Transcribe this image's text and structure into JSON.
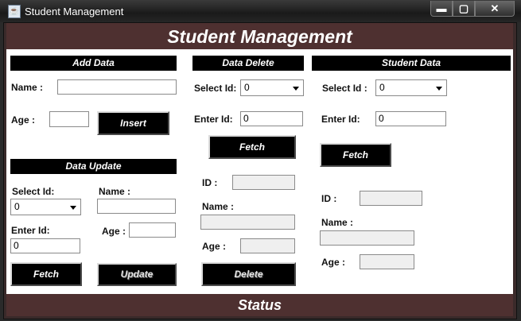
{
  "window": {
    "title": "Student Management",
    "app_icon_glyph": "☕",
    "min_glyph": "▬",
    "max_glyph": "▢",
    "close_glyph": "✕"
  },
  "header": {
    "title": "Student Management"
  },
  "add_data": {
    "title": "Add Data",
    "name_label": "Name :",
    "name_value": "",
    "age_label": "Age :",
    "age_value": "",
    "insert_label": "Insert"
  },
  "data_update": {
    "title": "Data Update",
    "select_id_label": "Select Id:",
    "select_id_value": "0",
    "name_label": "Name :",
    "name_value": "",
    "enter_id_label": "Enter Id:",
    "enter_id_value": "0",
    "age_label": "Age :",
    "age_value": "",
    "fetch_label": "Fetch",
    "update_label": "Update"
  },
  "data_delete": {
    "title": "Data Delete",
    "select_id_label": "Select Id:",
    "select_id_value": "0",
    "enter_id_label": "Enter Id:",
    "enter_id_value": "0",
    "fetch_label": "Fetch",
    "id_label": "ID :",
    "id_value": "",
    "name_label": "Name :",
    "name_value": "",
    "age_label": "Age :",
    "age_value": "",
    "delete_label": "Delete"
  },
  "student_data": {
    "title": "Student Data",
    "select_id_label": "Select Id :",
    "select_id_value": "0",
    "enter_id_label": "Enter Id:",
    "enter_id_value": "0",
    "fetch_label": "Fetch",
    "id_label": "ID :",
    "id_value": "",
    "name_label": "Name :",
    "name_value": "",
    "age_label": "Age :",
    "age_value": ""
  },
  "status": {
    "text": "Status"
  },
  "colors": {
    "frame": "#3a2a2a",
    "header_bg": "#4e3030",
    "section_bg": "#000000",
    "button_bg": "#000000",
    "panel_bg": "#ffffff"
  }
}
